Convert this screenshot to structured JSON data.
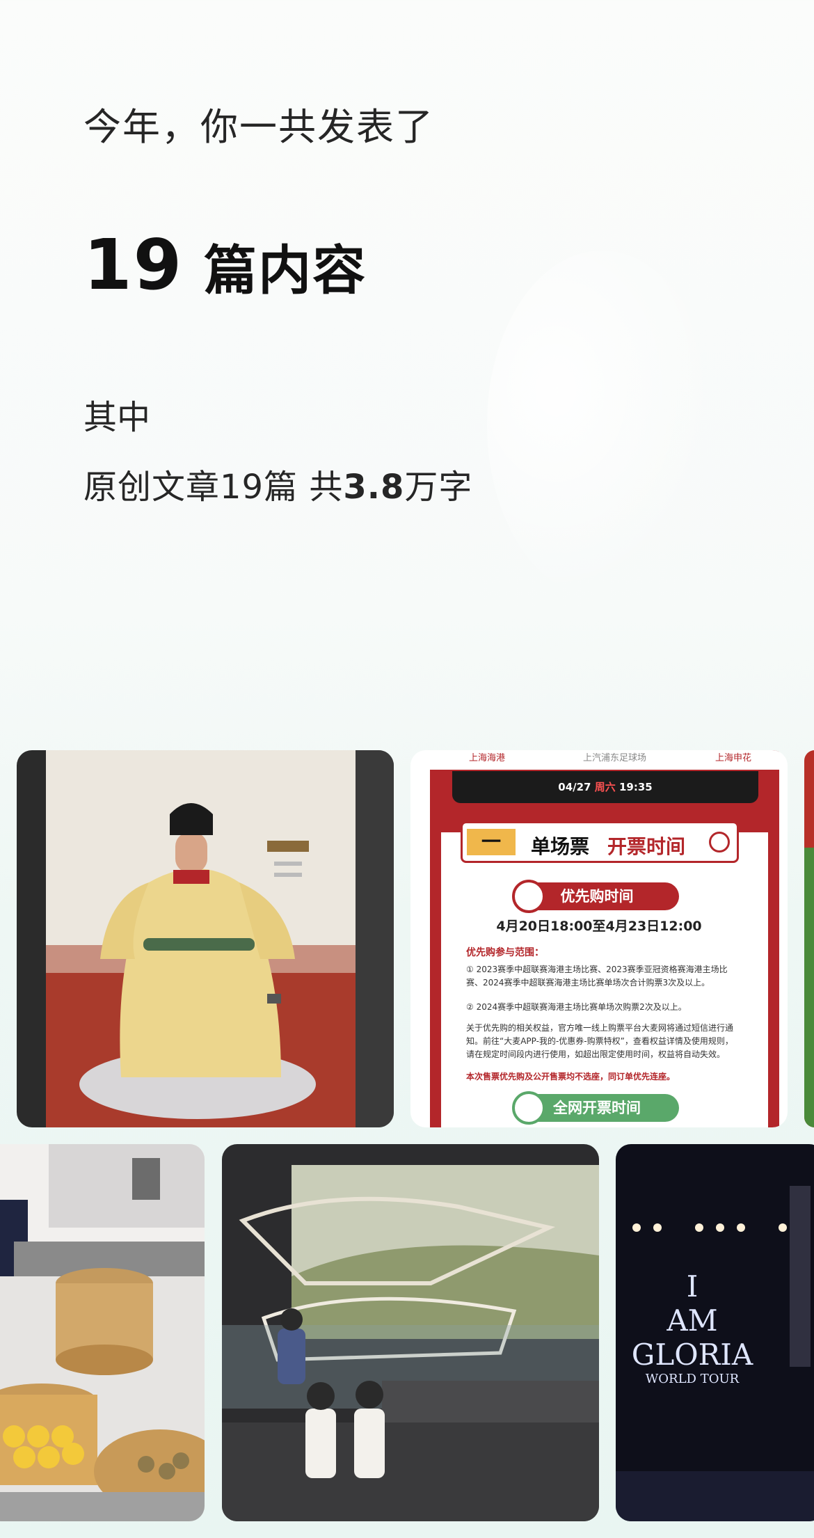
{
  "summary": {
    "intro": "今年，你一共发表了",
    "count": "19",
    "unit": "篇内容",
    "sub_label": "其中",
    "stat_prefix": "原创文章19篇  共",
    "stat_number": "3.8",
    "stat_suffix": "万字"
  },
  "photos": [
    {
      "subject": "portrait-painting"
    },
    {
      "subject": "ticket-poster"
    },
    {
      "subject": "steamer-food"
    },
    {
      "subject": "dinosaur-museum"
    },
    {
      "subject": "concert"
    }
  ],
  "poster": {
    "team_left": "上海海港",
    "venue": "上汽浦东足球场",
    "team_right": "上海申花",
    "date": "04/27",
    "weekday": "周六",
    "kickoff": "19:35",
    "section_number": "一",
    "title_a": "单场票",
    "title_b": "开票时间",
    "priority_label": "优先购时间",
    "priority_time": "4月20日18:00至4月23日12:00",
    "scope_title": "优先购参与范围：",
    "scope_1": "① 2023赛季中超联赛海港主场比赛、2023赛季亚冠资格赛海港主场比赛、2024赛季中超联赛海港主场比赛单场次合计购票3次及以上。",
    "scope_2": "② 2024赛季中超联赛海港主场比赛单场次购票2次及以上。",
    "notice": "关于优先购的相关权益，官方唯一线上购票平台大麦网将通过短信进行通知。前往“大麦APP-我的-优惠券-购票特权”，查看权益详情及使用规则，请在规定时间段内进行使用，如超出限定使用时间，权益将自动失效。",
    "red_note": "本次售票优先购及公开售票均不选座，同订单优先连座。",
    "public_label": "全网开票时间"
  },
  "concert": {
    "line1": "I",
    "line2": "AM",
    "line3": "GLORIA",
    "line4": "WORLD TOUR"
  },
  "colors": {
    "poster_red": "#b3262a",
    "poster_green": "#5aa86a",
    "background": "#eef7f4"
  }
}
